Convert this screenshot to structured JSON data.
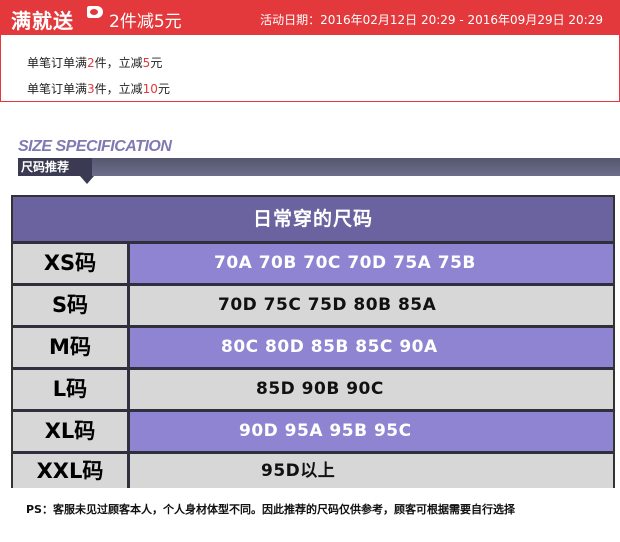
{
  "promo": {
    "title": "满就送",
    "subtitle": "2件减5元",
    "date_range": "活动日期：2016年02月12日 20:29 - 2016年09月29日 20:29",
    "rules": [
      {
        "prefix": "单笔订单满",
        "count": "2",
        "mid": "件，立减",
        "amount": "5",
        "suffix": "元"
      },
      {
        "prefix": "单笔订单满",
        "count": "3",
        "mid": "件，立减",
        "amount": "10",
        "suffix": "元"
      }
    ]
  },
  "spec": {
    "title_en": "SIZE SPECIFICATION",
    "tab_label": "尺码推荐"
  },
  "size_table": {
    "header": "日常穿的尺码",
    "rows": [
      {
        "size": "XS码",
        "values": "70A 70B 70C 70D 75A 75B"
      },
      {
        "size": "S码",
        "values": "70D 75C 75D 80B 85A"
      },
      {
        "size": "M码",
        "values": "80C 80D 85B 85C 90A"
      },
      {
        "size": "L码",
        "values": "85D 90B 90C"
      },
      {
        "size": "XL码",
        "values": "90D 95A 95B 95C"
      },
      {
        "size": "XXL码",
        "values": "95D以上"
      }
    ]
  },
  "footnote": "PS：客服未见过顾客本人，个人身材体型不同。因此推荐的尺码仅供参考，顾客可根据需要自行选择",
  "colors": {
    "promo_red": "#e3393c",
    "table_purple": "#8f84d2",
    "header_purple": "#6b639f",
    "row_gray": "#d7d7d7"
  }
}
